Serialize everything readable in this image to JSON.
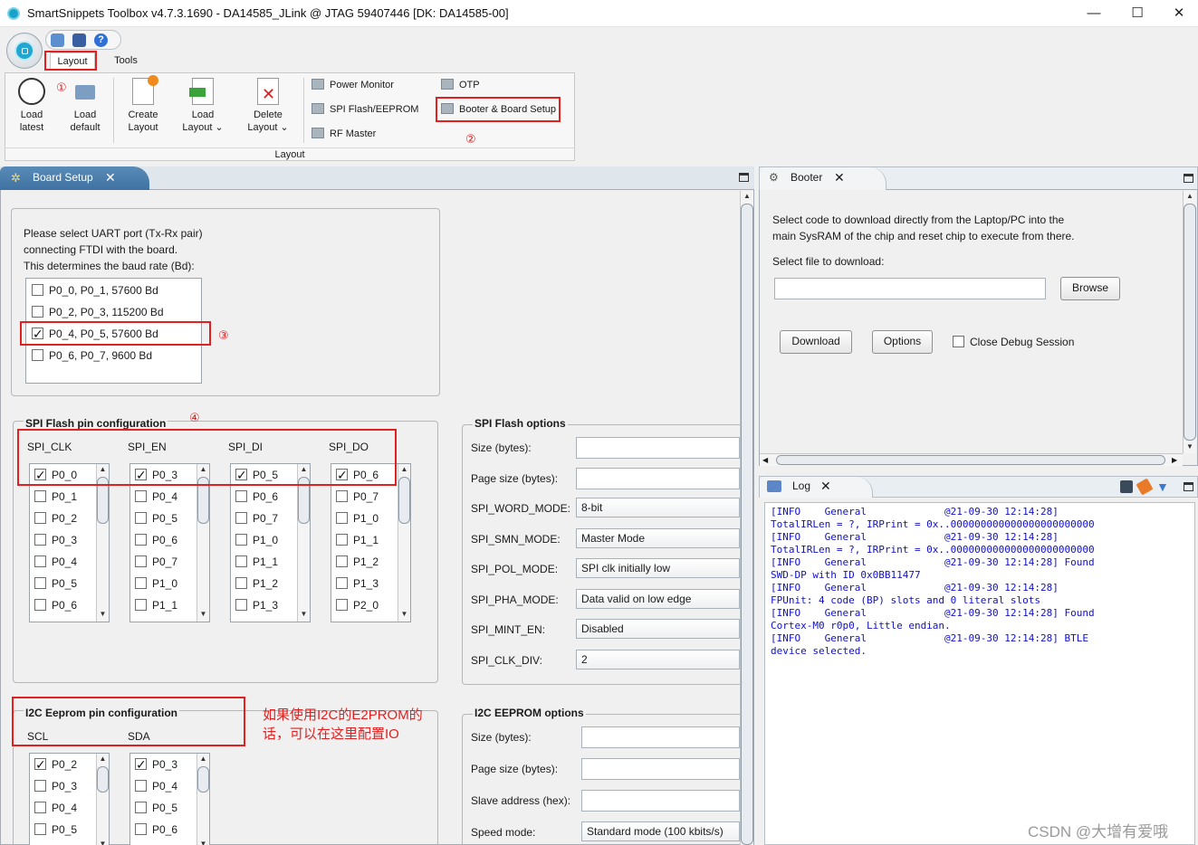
{
  "window": {
    "title": "SmartSnippets Toolbox v4.7.3.1690 - DA14585_JLink @ JTAG 59407446 [DK: DA14585-00]",
    "min": "—",
    "max": "☐",
    "close": "✕"
  },
  "ribbon": {
    "tabs": [
      "Layout",
      "Tools"
    ],
    "buttons": [
      {
        "line1": "Load",
        "line2": "latest"
      },
      {
        "line1": "Load",
        "line2": "default"
      },
      {
        "line1": "Create",
        "line2": "Layout"
      },
      {
        "line1": "Load",
        "line2": "Layout ⌄"
      },
      {
        "line1": "Delete",
        "line2": "Layout ⌄"
      }
    ],
    "small_items": [
      "Power Monitor",
      "SPI Flash/EEPROM",
      "RF Master",
      "OTP",
      "Booter & Board Setup"
    ],
    "group_label": "Layout"
  },
  "annotations": {
    "a1": "①",
    "a2": "②",
    "a3": "③",
    "a4": "④",
    "note_line1": "如果使用I2C的E2PROM的",
    "note_line2": "话，可以在这里配置IO"
  },
  "board_setup": {
    "tab_label": "Board Setup",
    "uart": {
      "desc1": "Please select UART port (Tx-Rx pair)",
      "desc2": "connecting FTDI with the board.",
      "desc3": "This determines the baud rate (Bd):",
      "options": [
        {
          "label": "P0_0, P0_1, 57600 Bd",
          "checked": false
        },
        {
          "label": "P0_2, P0_3, 115200 Bd",
          "checked": false
        },
        {
          "label": "P0_4, P0_5, 57600 Bd",
          "checked": true
        },
        {
          "label": "P0_6, P0_7, 9600 Bd",
          "checked": false
        }
      ]
    },
    "spi_pins": {
      "title": "SPI Flash pin configuration",
      "columns": [
        {
          "header": "SPI_CLK",
          "items": [
            "P0_0",
            "P0_1",
            "P0_2",
            "P0_3",
            "P0_4",
            "P0_5",
            "P0_6"
          ],
          "checked": 0
        },
        {
          "header": "SPI_EN",
          "items": [
            "P0_3",
            "P0_4",
            "P0_5",
            "P0_6",
            "P0_7",
            "P1_0",
            "P1_1"
          ],
          "checked": 0
        },
        {
          "header": "SPI_DI",
          "items": [
            "P0_5",
            "P0_6",
            "P0_7",
            "P1_0",
            "P1_1",
            "P1_2",
            "P1_3"
          ],
          "checked": 0
        },
        {
          "header": "SPI_DO",
          "items": [
            "P0_6",
            "P0_7",
            "P1_0",
            "P1_1",
            "P1_2",
            "P1_3",
            "P2_0"
          ],
          "checked": 0
        }
      ]
    },
    "spi_options": {
      "title": "SPI Flash options",
      "rows": [
        {
          "label": "Size (bytes):",
          "value": "",
          "kind": "field"
        },
        {
          "label": "Page size (bytes):",
          "value": "",
          "kind": "field"
        },
        {
          "label": "SPI_WORD_MODE:",
          "value": "8-bit",
          "kind": "combo"
        },
        {
          "label": "SPI_SMN_MODE:",
          "value": "Master Mode",
          "kind": "combo"
        },
        {
          "label": "SPI_POL_MODE:",
          "value": "SPI clk initially low",
          "kind": "combo"
        },
        {
          "label": "SPI_PHA_MODE:",
          "value": "Data valid on low edge",
          "kind": "combo"
        },
        {
          "label": "SPI_MINT_EN:",
          "value": "Disabled",
          "kind": "combo"
        },
        {
          "label": "SPI_CLK_DIV:",
          "value": "2",
          "kind": "combo"
        }
      ]
    },
    "i2c_pins": {
      "title": "I2C Eeprom pin configuration",
      "columns": [
        {
          "header": "SCL",
          "items": [
            "P0_2",
            "P0_3",
            "P0_4",
            "P0_5"
          ],
          "checked": 0
        },
        {
          "header": "SDA",
          "items": [
            "P0_3",
            "P0_4",
            "P0_5",
            "P0_6"
          ],
          "checked": 0
        }
      ]
    },
    "i2c_options": {
      "title": "I2C EEPROM options",
      "rows": [
        {
          "label": "Size (bytes):",
          "value": "",
          "kind": "field"
        },
        {
          "label": "Page size (bytes):",
          "value": "",
          "kind": "field"
        },
        {
          "label": "Slave address (hex):",
          "value": "",
          "kind": "field"
        },
        {
          "label": "Speed mode:",
          "value": "Standard mode (100 kbits/s)",
          "kind": "combo"
        }
      ]
    }
  },
  "booter": {
    "tab_label": "Booter",
    "desc1": "Select code to download directly from the Laptop/PC into the",
    "desc2": "main SysRAM of the chip and reset chip to execute from there.",
    "file_label": "Select file to download:",
    "file_value": "",
    "browse": "Browse",
    "download": "Download",
    "options": "Options",
    "close_debug": "Close Debug Session"
  },
  "log": {
    "tab_label": "Log",
    "lines": [
      "[INFO    General             @21-09-30 12:14:28]",
      "TotalIRLen = ?, IRPrint = 0x..000000000000000000000000",
      "[INFO    General             @21-09-30 12:14:28]",
      "TotalIRLen = ?, IRPrint = 0x..000000000000000000000000",
      "[INFO    General             @21-09-30 12:14:28] Found",
      "SWD-DP with ID 0x0BB11477",
      "[INFO    General             @21-09-30 12:14:28]",
      "FPUnit: 4 code (BP) slots and 0 literal slots",
      "[INFO    General             @21-09-30 12:14:28] Found",
      "Cortex-M0 r0p0, Little endian.",
      "[INFO    General             @21-09-30 12:14:28] BTLE",
      "device selected."
    ]
  },
  "watermark": "CSDN @大增有爱哦",
  "colors": {
    "annotation_red": "#e32020",
    "log_blue": "#1010c8",
    "tab_blue": "#3f72a2"
  }
}
